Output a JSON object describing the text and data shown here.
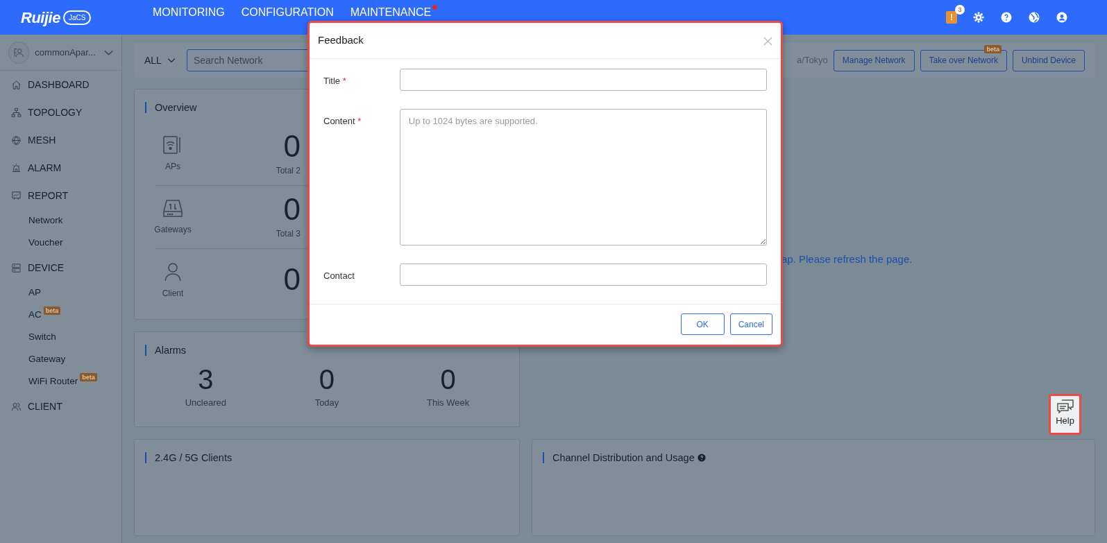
{
  "header": {
    "logo": {
      "brand": "Ruijie",
      "product": "JaCS"
    },
    "nav": [
      {
        "label": "MONITORING",
        "dot": false
      },
      {
        "label": "CONFIGURATION",
        "dot": false
      },
      {
        "label": "MAINTENANCE",
        "dot": true
      }
    ],
    "alert_mark": "!",
    "alert_count": "3"
  },
  "sidebar": {
    "account": "commonApar...",
    "items": [
      {
        "label": "DASHBOARD"
      },
      {
        "label": "TOPOLOGY"
      },
      {
        "label": "MESH"
      },
      {
        "label": "ALARM"
      },
      {
        "label": "REPORT",
        "children": [
          {
            "label": "Network"
          },
          {
            "label": "Voucher"
          }
        ]
      },
      {
        "label": "DEVICE",
        "children": [
          {
            "label": "AP"
          },
          {
            "label": "AC",
            "badge": "beta"
          },
          {
            "label": "Switch"
          },
          {
            "label": "Gateway"
          },
          {
            "label": "WiFi Router",
            "badge": "beta"
          }
        ]
      },
      {
        "label": "CLIENT"
      }
    ]
  },
  "toolbar": {
    "scope": "ALL",
    "search": {
      "placeholder": "Search Network"
    },
    "timezone": "a/Tokyo",
    "buttons": [
      {
        "label": "Manage Network"
      },
      {
        "label": "Take over Network",
        "badge": "beta"
      },
      {
        "label": "Unbind Device"
      }
    ]
  },
  "overview": {
    "title": "Overview",
    "rows": [
      {
        "label": "APs",
        "value": "0",
        "caption": "Total 2"
      },
      {
        "label": "Gateways",
        "value": "0",
        "caption": "Total 3"
      },
      {
        "label": "Client",
        "value": "0"
      }
    ]
  },
  "notice": "ap. Please refresh the page.",
  "alarms": {
    "title": "Alarms",
    "stats": [
      {
        "value": "3",
        "label": "Uncleared"
      },
      {
        "value": "0",
        "label": "Today"
      },
      {
        "value": "0",
        "label": "This Week"
      }
    ]
  },
  "panels": [
    {
      "title": "2.4G / 5G Clients",
      "help": false
    },
    {
      "title": "Channel Distribution and Usage",
      "help": true
    }
  ],
  "dialog": {
    "title": "Feedback",
    "required_mark": "*",
    "fields": [
      {
        "kind": "input",
        "label": "Title",
        "required": true
      },
      {
        "kind": "textarea",
        "label": "Content",
        "required": true,
        "placeholder": "Up to 1024 bytes are supported."
      },
      {
        "kind": "input",
        "label": "Contact",
        "required": false
      }
    ],
    "buttons": [
      {
        "label": "OK"
      },
      {
        "label": "Cancel"
      }
    ]
  },
  "help_button": {
    "label": "Help"
  }
}
